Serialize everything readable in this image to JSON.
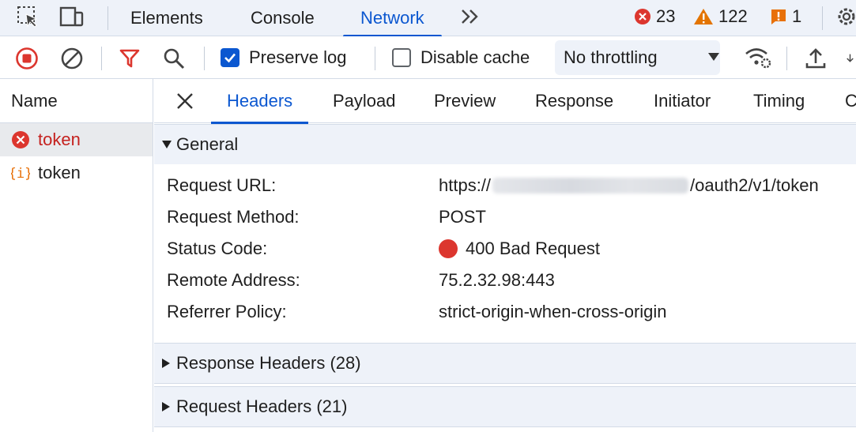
{
  "main_tabs": [
    {
      "label": "Elements"
    },
    {
      "label": "Console"
    },
    {
      "label": "Network"
    }
  ],
  "counters": {
    "errors": "23",
    "warnings": "122",
    "issues": "1"
  },
  "toolbar": {
    "preserve_log": {
      "label": "Preserve log",
      "checked": true
    },
    "disable_cache": {
      "label": "Disable cache",
      "checked": false
    },
    "throttling": "No throttling"
  },
  "requests": {
    "header": "Name",
    "items": [
      {
        "name": "token",
        "status": "error"
      },
      {
        "name": "token",
        "status": "ok"
      }
    ]
  },
  "detail_tabs": [
    "Headers",
    "Payload",
    "Preview",
    "Response",
    "Initiator",
    "Timing",
    "C"
  ],
  "general": {
    "title": "General",
    "rows": [
      {
        "key": "Request URL:",
        "value_prefix": "https://",
        "value_suffix": "/oauth2/v1/token"
      },
      {
        "key": "Request Method:",
        "value": "POST"
      },
      {
        "key": "Status Code:",
        "value": "400 Bad Request"
      },
      {
        "key": "Remote Address:",
        "value": "75.2.32.98:443"
      },
      {
        "key": "Referrer Policy:",
        "value": "strict-origin-when-cross-origin"
      }
    ]
  },
  "response_headers": "Response Headers (28)",
  "request_headers": "Request Headers (21)",
  "colors": {
    "accent": "#0b57d0",
    "error": "#dc362e",
    "warning": "#e37400",
    "issue": "#e8710a"
  }
}
